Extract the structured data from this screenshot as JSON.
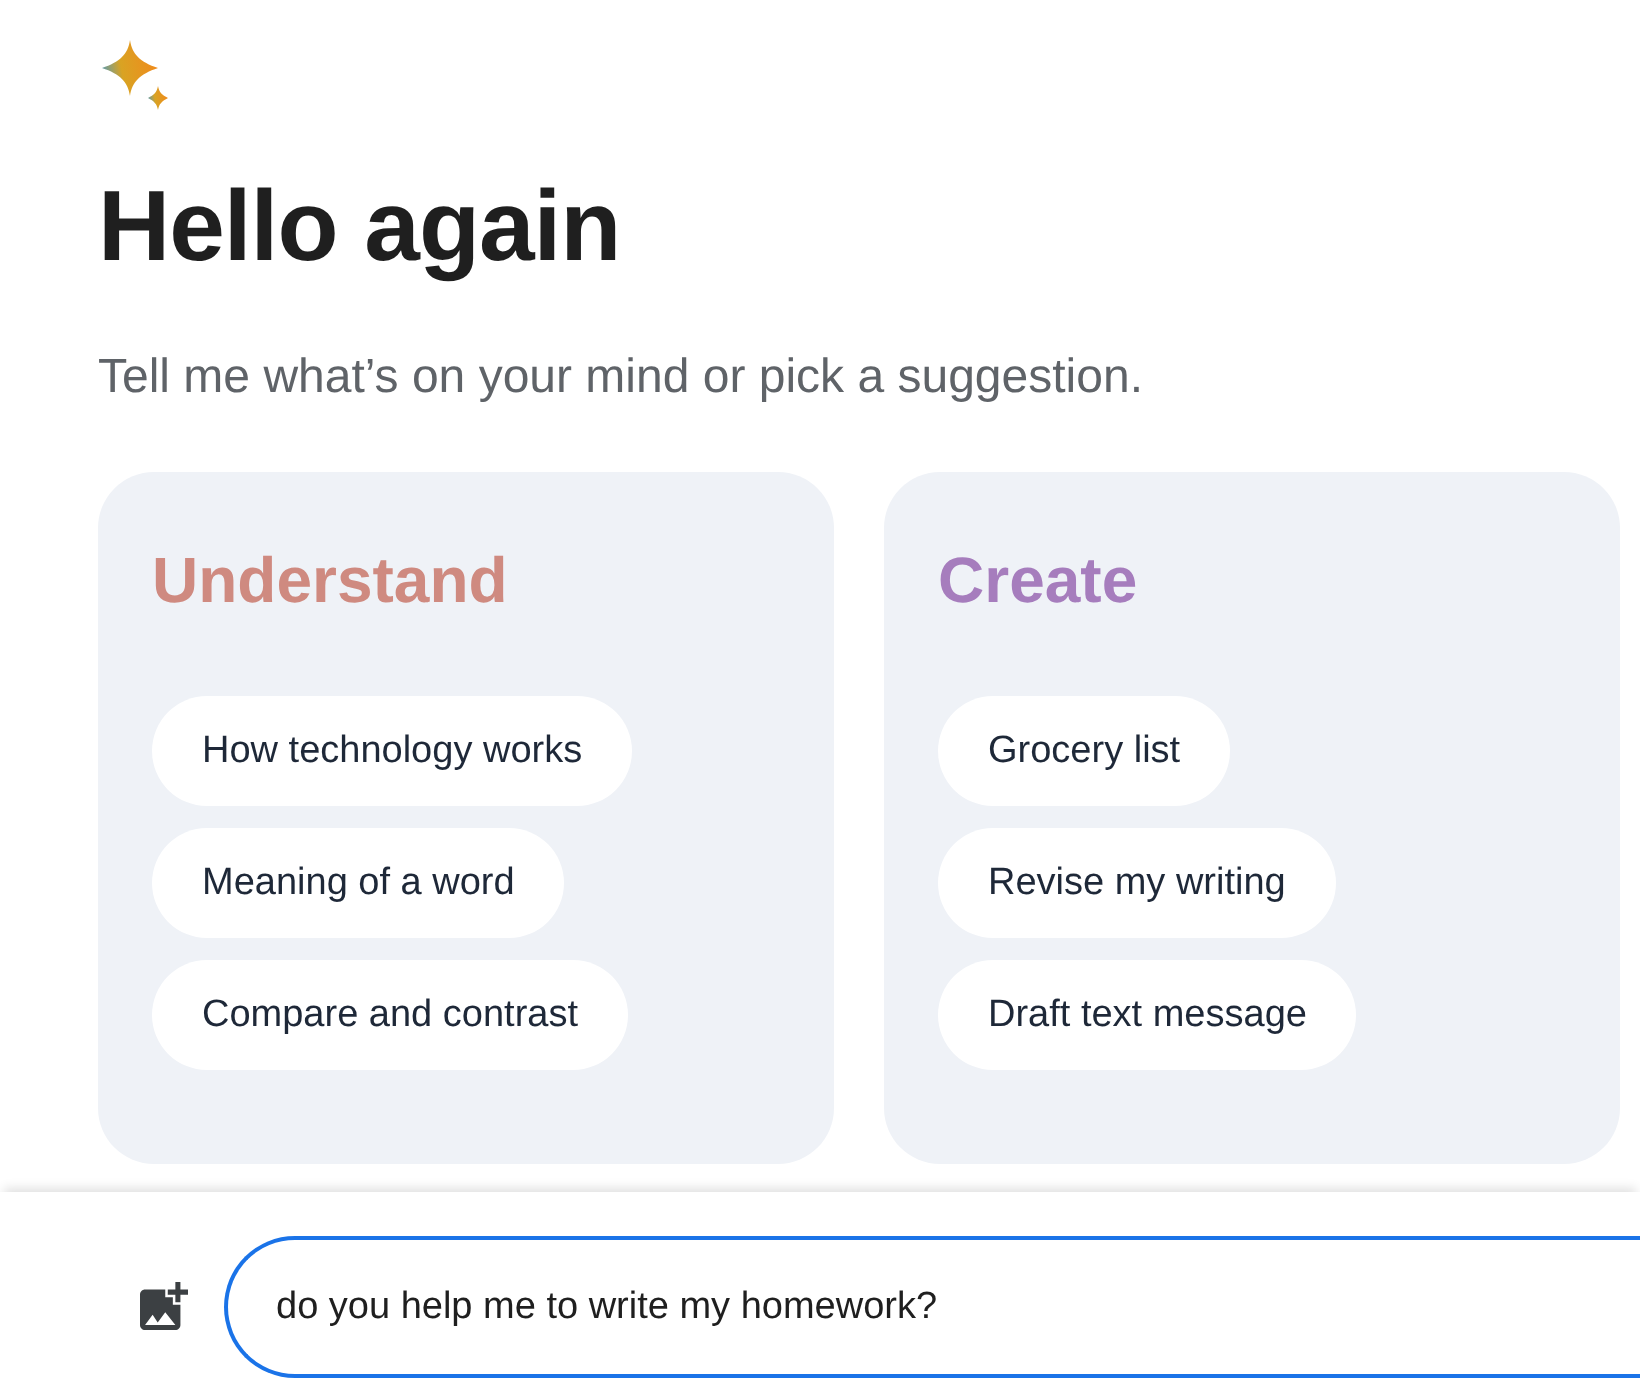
{
  "greeting": {
    "title": "Hello again",
    "subtitle": "Tell me what’s on your mind or pick a suggestion."
  },
  "categories": [
    {
      "title": "Understand",
      "color": "#cf8a80",
      "suggestions": [
        "How technology works",
        "Meaning of a word",
        "Compare and contrast"
      ]
    },
    {
      "title": "Create",
      "color": "#a67dbd",
      "suggestions": [
        "Grocery list",
        "Revise my writing",
        "Draft text message"
      ]
    }
  ],
  "prompt": {
    "value": "do you help me to write my homework?"
  }
}
